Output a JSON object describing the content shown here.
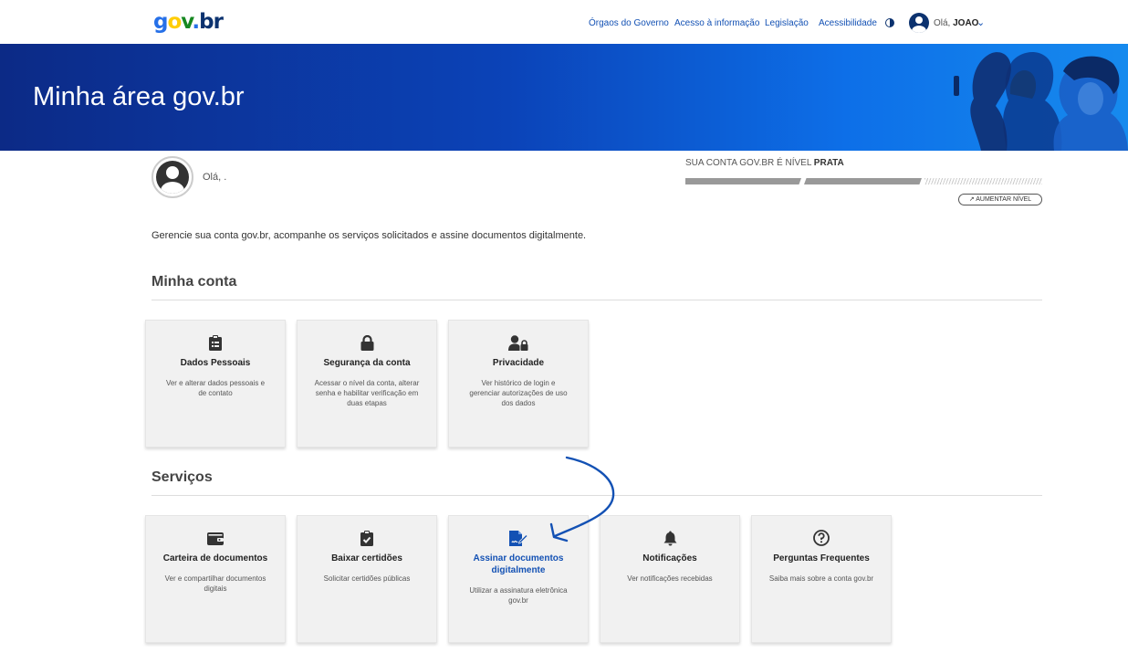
{
  "header": {
    "logo": {
      "g": "g",
      "o": "o",
      "v": "v",
      "dot": ".",
      "b": "b",
      "r": "r"
    },
    "nav": [
      "Órgaos do Governo",
      "Acesso à informação",
      "Legislação",
      "Acessibilidade"
    ],
    "greeting_prefix": "Olá,",
    "user_name": "JOAO",
    "colors": {
      "primary": "#1351b4",
      "dark": "#0c326f"
    }
  },
  "banner": {
    "title": "Minha área gov.br"
  },
  "profile": {
    "hello": "Olá, .",
    "level_prefix": "SUA CONTA GOV.BR É NÍVEL",
    "level_value": "PRATA",
    "level_progress": "2/3",
    "raise_level": "AUMENTAR NÍVEL"
  },
  "intro": "Gerencie sua conta gov.br, acompanhe os serviços solicitados e assine documentos digitalmente.",
  "minha_conta": {
    "title": "Minha conta",
    "cards": [
      {
        "title": "Dados Pessoais",
        "desc": "Ver e alterar dados pessoais e de contato",
        "icon": "clipboard-list-icon"
      },
      {
        "title": "Segurança da conta",
        "desc": "Acessar o nível da conta, alterar senha e habilitar verificação em duas etapas",
        "icon": "lock-icon"
      },
      {
        "title": "Privacidade",
        "desc": "Ver histórico de login e gerenciar autorizações de uso dos dados",
        "icon": "user-lock-icon"
      }
    ]
  },
  "servicos": {
    "title": "Serviços",
    "cards": [
      {
        "title": "Carteira de documentos",
        "desc": "Ver e compartilhar documentos digitais",
        "icon": "wallet-icon"
      },
      {
        "title": "Baixar certidões",
        "desc": "Solicitar certidões públicas",
        "icon": "clipboard-check-icon"
      },
      {
        "title": "Assinar documentos digitalmente",
        "desc": "Utilizar a assinatura eletrônica gov.br",
        "icon": "file-signature-icon"
      },
      {
        "title": "Notificações",
        "desc": "Ver notificações recebidas",
        "icon": "bell-icon"
      },
      {
        "title": "Perguntas Frequentes",
        "desc": "Saiba mais sobre a conta gov.br",
        "icon": "question-circle-icon"
      }
    ]
  }
}
